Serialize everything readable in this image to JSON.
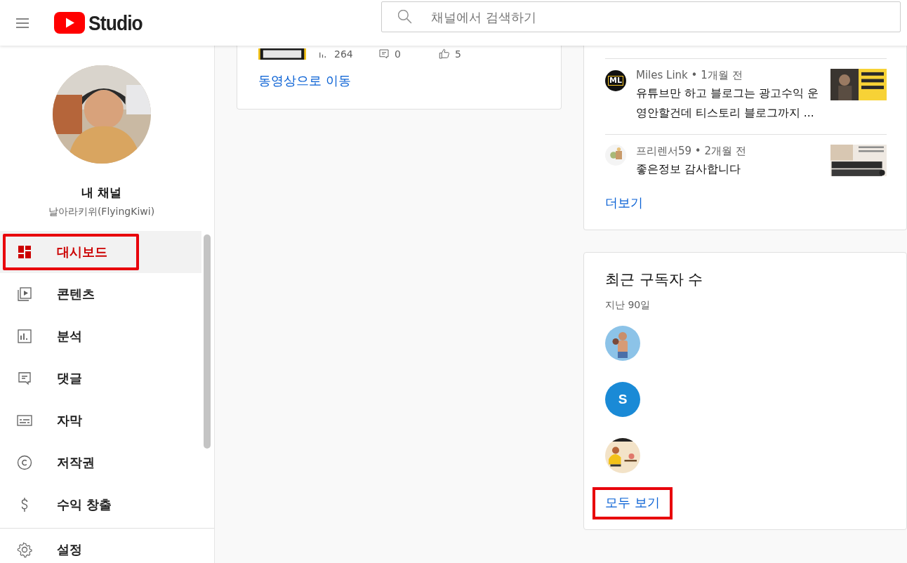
{
  "header": {
    "logo_text": "Studio",
    "search": {
      "placeholder": "채널에서 검색하기"
    }
  },
  "sidebar": {
    "channel": {
      "avatar": {
        "kind": "picture"
      },
      "title": "내 채널",
      "name": "날아라키위(FlyingKiwi)"
    },
    "items": [
      {
        "label": "대시보드",
        "selected": true,
        "highlighted": true
      },
      {
        "label": "콘텐츠",
        "selected": false,
        "highlighted": false
      },
      {
        "label": "분석",
        "selected": false,
        "highlighted": false
      },
      {
        "label": "댓글",
        "selected": false,
        "highlighted": false
      },
      {
        "label": "자막",
        "selected": false,
        "highlighted": false
      },
      {
        "label": "저작권",
        "selected": false,
        "highlighted": false
      },
      {
        "label": "수익 창출",
        "selected": false,
        "highlighted": false
      }
    ],
    "footer_items": [
      {
        "label": "설정",
        "selected": false,
        "highlighted": false
      }
    ]
  },
  "video_card": {
    "thumbnail": {
      "kind": "picture"
    },
    "stats": [
      {
        "value": "264"
      },
      {
        "value": "0"
      },
      {
        "value": "5"
      }
    ],
    "link": "동영상으로 이동"
  },
  "comments_card": {
    "comments": [
      {
        "meta": "Miles Link • 1개월 전",
        "text": "유튜브만 하고 블로그는 광고수익 운영안할건데 티스토리 블로그까지 ...",
        "avatar": {
          "kind": "logo",
          "text": "ML"
        }
      },
      {
        "meta": "프리렌서59 • 2개월 전",
        "text": "좋은정보 감사합니다",
        "avatar": {
          "kind": "picture"
        }
      }
    ],
    "link": "더보기"
  },
  "subscribers_card": {
    "title": "최근 구독자 수",
    "subtitle": "지난 90일",
    "subscribers": [
      {
        "kind": "picture"
      },
      {
        "kind": "letter",
        "text": "S",
        "color": "#1a8ad6"
      },
      {
        "kind": "picture"
      }
    ],
    "link": "모두 보기",
    "link_highlighted": true
  }
}
